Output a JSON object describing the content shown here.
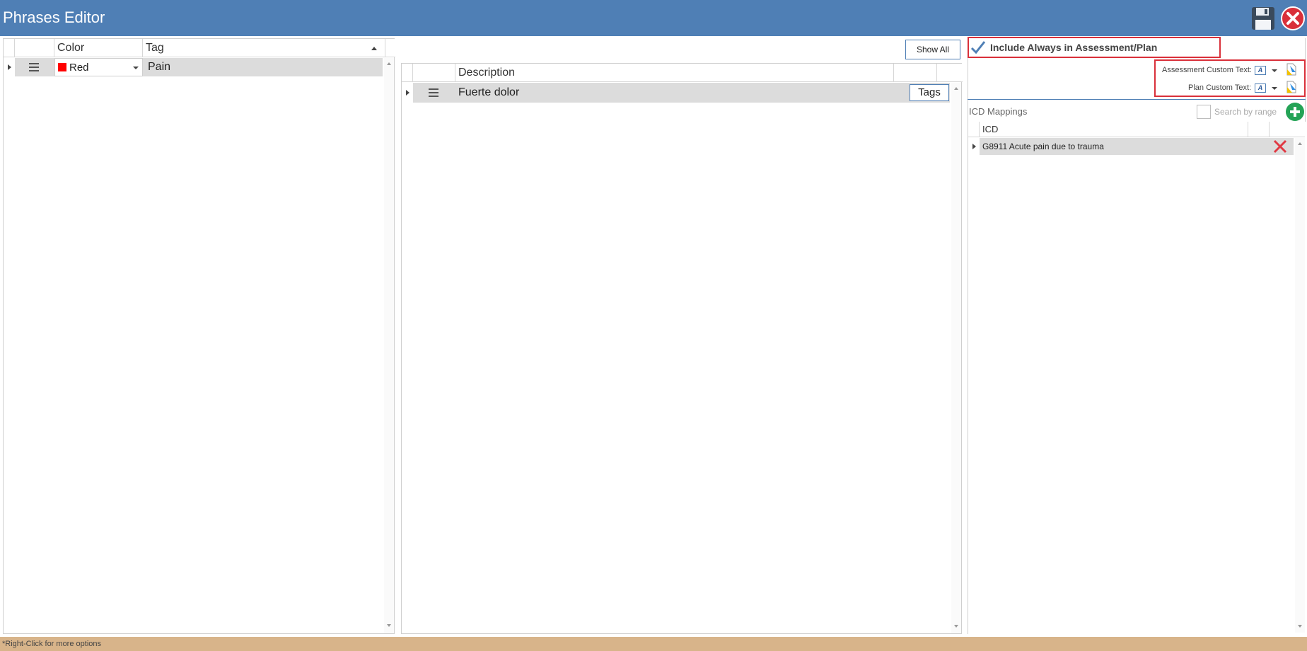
{
  "window": {
    "title": "Phrases Editor"
  },
  "tags_grid": {
    "columns": [
      "Color",
      "Tag"
    ],
    "rows": [
      {
        "color_name": "Red",
        "color_hex": "#ff0000",
        "tag": "Pain"
      }
    ]
  },
  "phrases_grid": {
    "show_all_label": "Show All",
    "columns": [
      "Description"
    ],
    "rows": [
      {
        "description": "Fuerte dolor",
        "tags_label": "Tags"
      }
    ]
  },
  "assessment_plan": {
    "include_always_label": "Include Always in Assessment/Plan",
    "include_always_checked": true,
    "assessment_custom_text_label": "Assessment Custom Text:",
    "plan_custom_text_label": "Plan Custom Text:"
  },
  "icd": {
    "title": "ICD Mappings",
    "search_by_range_label": "Search by range",
    "search_by_range_checked": false,
    "columns": [
      "ICD"
    ],
    "rows": [
      {
        "code_description": "G8911 Acute pain due to trauma"
      }
    ]
  },
  "status": {
    "hint": "*Right-Click for more options"
  },
  "colors": {
    "titlebar": "#4f7fb5",
    "highlight": "#d9303a",
    "statusbar": "#d8b48a",
    "add": "#24a356"
  },
  "icons": [
    "save-icon",
    "close-icon",
    "checkmark-icon",
    "drag-handle-icon",
    "row-expand-icon",
    "plus-icon",
    "delete-icon",
    "text-format-icon",
    "document-icon"
  ]
}
